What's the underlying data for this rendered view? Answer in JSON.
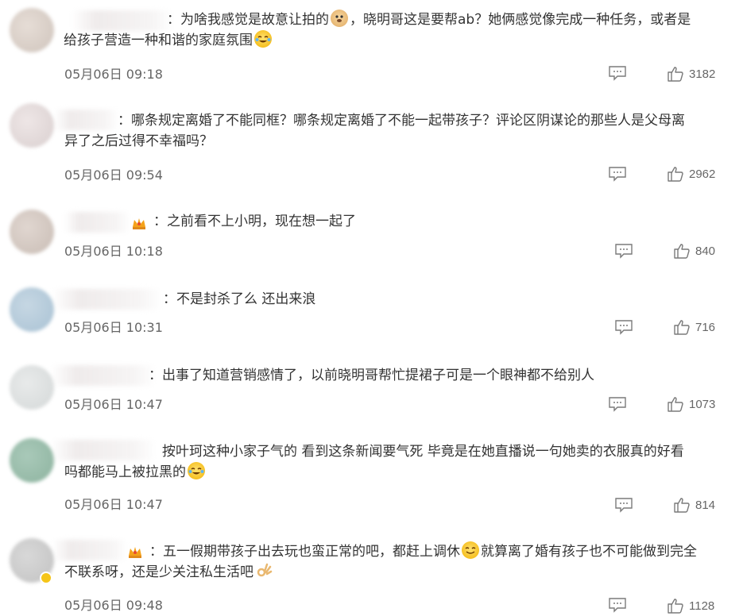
{
  "comments": [
    {
      "text_line1": "为啥我感觉是故意让拍的",
      "text_mid": "，晓明哥这是要帮ab？她俩感觉像完成一种任务，或者是",
      "text_line2": "给孩子营造一种和谐的家庭氛围",
      "time": "05月06日 09:18",
      "likes": "3182",
      "emoji1": "doge-emoji",
      "emoji2": "crying-laugh-emoji"
    },
    {
      "text_line1": "哪条规定离婚了不能同框？哪条规定离婚了不能一起带孩子？评论区阴谋论的那些人是父母离",
      "text_line2": "异了之后过得不幸福吗？",
      "time": "05月06日 09:54",
      "likes": "2962"
    },
    {
      "text_line1": "之前看不上小明，现在想一起了",
      "time": "05月06日 10:18",
      "likes": "840"
    },
    {
      "text_line1": "不是封杀了么 还出来浪",
      "time": "05月06日 10:31",
      "likes": "716"
    },
    {
      "text_line1": "出事了知道营销感情了，以前晓明哥帮忙提裙子可是一个眼神都不给别人",
      "time": "05月06日 10:47",
      "likes": "1073"
    },
    {
      "text_line1": "按叶珂这种小家子气的 看到这条新闻要气死 毕竟是在她直播说一句她卖的衣服真的好看",
      "text_line2": "吗都能马上被拉黑的",
      "time": "05月06日 10:47",
      "likes": "814"
    },
    {
      "text_line1": "五一假期带孩子出去玩也蛮正常的吧，都赶上调休",
      "text_mid": "就算离了婚有孩子也不可能做到完全",
      "text_line2": "不联系呀，还是少关注私生活吧",
      "time": "05月06日 09:48",
      "likes": "1128"
    }
  ],
  "colon": "：",
  "icons": {
    "reply": "comment-icon",
    "like": "thumbs-up-icon",
    "crown": "crown-badge-icon"
  },
  "colors": {
    "text": "#333333",
    "meta": "#666666",
    "icon": "#7a7a7a"
  }
}
